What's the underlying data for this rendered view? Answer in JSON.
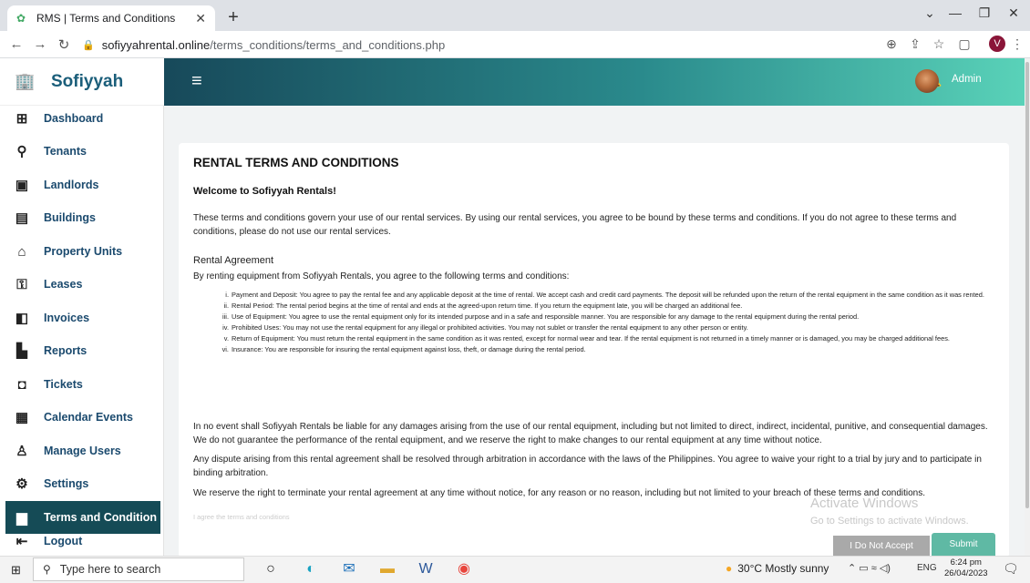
{
  "browser": {
    "tab_title": "RMS | Terms and Conditions",
    "url_host": "sofiyyahrental.online",
    "url_path": "/terms_conditions/terms_and_conditions.php",
    "profile_initial": "V"
  },
  "sidebar": {
    "brand": "Sofiyyah",
    "items": [
      {
        "label": "Dashboard",
        "icon": "grid-icon"
      },
      {
        "label": "Tenants",
        "icon": "person-icon"
      },
      {
        "label": "Landlords",
        "icon": "id-card-icon"
      },
      {
        "label": "Buildings",
        "icon": "building-icon"
      },
      {
        "label": "Property Units",
        "icon": "home-icon"
      },
      {
        "label": "Leases",
        "icon": "key-icon"
      },
      {
        "label": "Invoices",
        "icon": "invoice-icon"
      },
      {
        "label": "Reports",
        "icon": "bar-chart-icon"
      },
      {
        "label": "Tickets",
        "icon": "ticket-icon"
      },
      {
        "label": "Calendar Events",
        "icon": "calendar-icon"
      },
      {
        "label": "Manage Users",
        "icon": "add-user-icon"
      },
      {
        "label": "Settings",
        "icon": "gear-icon"
      },
      {
        "label": "Terms and Condition",
        "icon": "document-icon"
      },
      {
        "label": "Logout",
        "icon": "logout-icon"
      }
    ]
  },
  "header": {
    "user_label": "Admin"
  },
  "content": {
    "title": "RENTAL TERMS AND CONDITIONS",
    "welcome": "Welcome to Sofiyyah Rentals!",
    "intro": "These terms and conditions govern your use of our rental services. By using our rental services, you agree to be bound by these terms and conditions. If you do not agree to these terms and conditions, please do not use our rental services.",
    "section_title": "Rental Agreement",
    "section_intro": "By renting equipment from Sofiyyah Rentals, you agree to the following terms and conditions:",
    "terms": [
      {
        "num": "i.",
        "text": "Payment and Deposit: You agree to pay the rental fee and any applicable deposit at the time of rental. We accept cash and credit card payments. The deposit will be refunded upon the return of the rental equipment in the same condition as it was rented."
      },
      {
        "num": "ii.",
        "text": "Rental Period: The rental period begins at the time of rental and ends at the agreed-upon return time. If you return the equipment late, you will be charged an additional fee."
      },
      {
        "num": "iii.",
        "text": "Use of Equipment: You agree to use the rental equipment only for its intended purpose and in a safe and responsible manner. You are responsible for any damage to the rental equipment during the rental period."
      },
      {
        "num": "iv.",
        "text": "Prohibited Uses: You may not use the rental equipment for any illegal or prohibited activities. You may not sublet or transfer the rental equipment to any other person or entity."
      },
      {
        "num": "v.",
        "text": "Return of Equipment: You must return the rental equipment in the same condition as it was rented, except for normal wear and tear. If the rental equipment is not returned in a timely manner or is damaged, you may be charged additional fees."
      },
      {
        "num": "vi.",
        "text": "Insurance: You are responsible for insuring the rental equipment against loss, theft, or damage during the rental period."
      }
    ],
    "para1": "In no event shall Sofiyyah Rentals be liable for any damages arising from the use of our rental equipment, including but not limited to direct, indirect, incidental, punitive, and consequential damages. We do not guarantee the performance of the rental equipment, and we reserve the right to make changes to our rental equipment at any time without notice.",
    "para2": "Any dispute arising from this rental agreement shall be resolved through arbitration in accordance with the laws of the Philippines. You agree to waive your right to a trial by jury and to participate in binding arbitration.",
    "para3": "We reserve the right to terminate your rental agreement at any time without notice, for any reason or no reason, including but not limited to your breach of these terms and conditions.",
    "agree_label": "I agree the terms and conditions",
    "btn_decline": "I Do Not Accept",
    "btn_submit": "Submit"
  },
  "watermark": {
    "line1": "Activate Windows",
    "line2": "Go to Settings to activate Windows."
  },
  "taskbar": {
    "search_placeholder": "Type here to search",
    "weather": "30°C  Mostly sunny",
    "lang": "ENG",
    "time": "6:24 pm",
    "date": "26/04/2023"
  },
  "colors": {
    "header_gradient_start": "#17495a",
    "header_gradient_end": "#5ad3b9",
    "active_nav": "#154b56",
    "submit": "#5fb9a4",
    "decline": "#a9a9a9"
  }
}
